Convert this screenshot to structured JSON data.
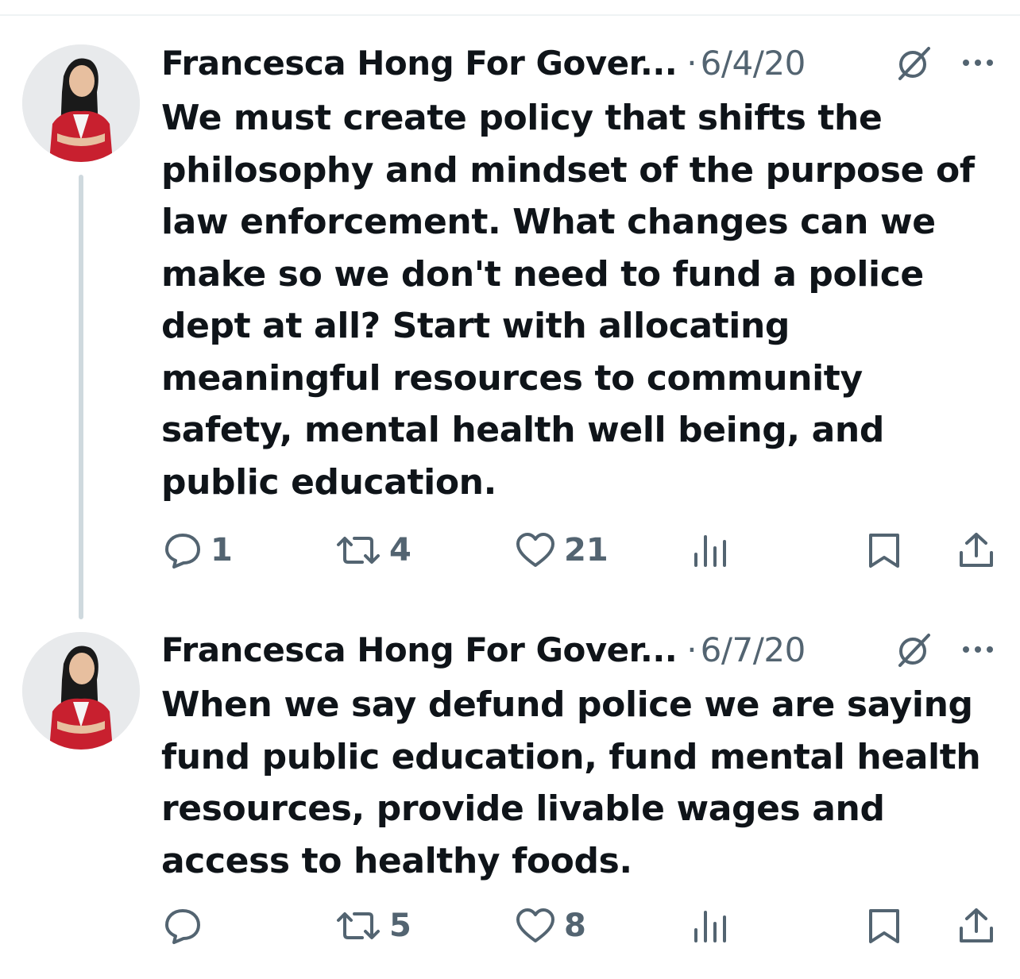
{
  "tweets": [
    {
      "author": "Francesca Hong For Gover...",
      "separator": "·",
      "date": "6/4/20",
      "text": "We must create policy that shifts the philosophy and mindset of the purpose of law enforcement. What changes can we make so we don't need to fund a police dept at all? Start with allocating meaningful resources to community safety, mental health well being, and public education.",
      "replies": "1",
      "reposts": "4",
      "likes": "21"
    },
    {
      "author": "Francesca Hong For Gover...",
      "separator": "·",
      "date": "6/7/20",
      "text": "When we say defund police we are saying fund public education, fund mental health resources, provide livable wages and access to healthy foods.",
      "replies": "",
      "reposts": "5",
      "likes": "8"
    }
  ],
  "icons": {
    "reply": "reply-icon",
    "repost": "repost-icon",
    "like": "heart-icon",
    "views": "analytics-icon",
    "bookmark": "bookmark-icon",
    "share": "share-icon",
    "grok": "grok-icon",
    "more": "more-icon"
  },
  "colors": {
    "text": "#0f1419",
    "secondary": "#536471",
    "thread_line": "#cfd9de",
    "avatar_jacket": "#c8202f"
  }
}
